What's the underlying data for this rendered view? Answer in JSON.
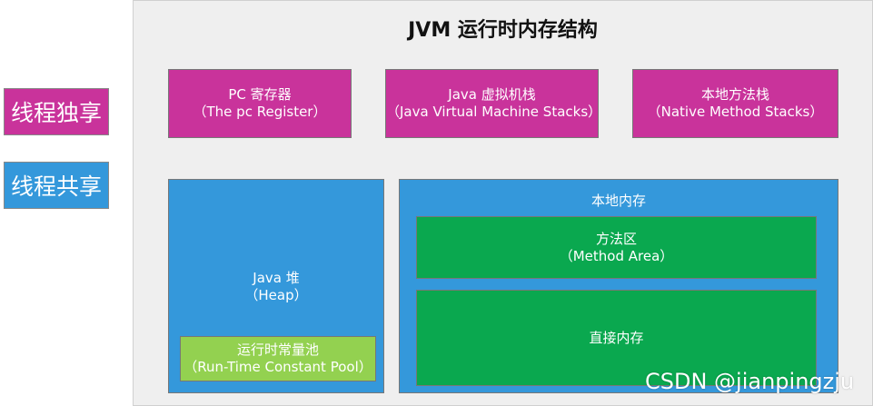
{
  "legend": {
    "exclusive_label": "线程独享",
    "shared_label": "线程共享"
  },
  "title": "JVM 运行时内存结构",
  "thread_private": {
    "pc": {
      "name": "PC 寄存器",
      "english": "（The pc Register）"
    },
    "jvm_stack": {
      "name": "Java 虚拟机栈",
      "english": "（Java Virtual Machine Stacks）"
    },
    "native_stack": {
      "name": "本地方法栈",
      "english": "（Native Method Stacks）"
    }
  },
  "heap": {
    "name": "Java 堆",
    "english": "（Heap）",
    "runtime_constant_pool": {
      "name": "运行时常量池",
      "english": "（Run-Time Constant Pool）"
    }
  },
  "local_memory": {
    "name": "本地内存",
    "method_area": {
      "name": "方法区",
      "english": "（Method Area）"
    },
    "direct_memory": {
      "name": "直接内存"
    }
  },
  "watermark": "CSDN @jianpingzju",
  "colors": {
    "thread_exclusive": "#c9339b",
    "thread_shared": "#3498db",
    "method_area": "#0aa84f",
    "constant_pool": "#93d150",
    "panel_background": "#efefef"
  }
}
